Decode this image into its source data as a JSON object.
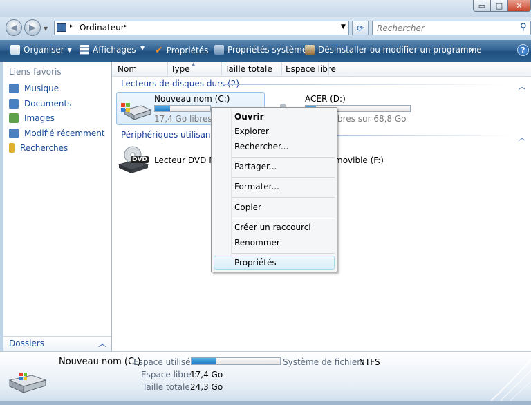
{
  "window": {
    "min_glyph": "▭",
    "max_glyph": "□",
    "close_glyph": "✕"
  },
  "address": {
    "path": "Ordinateur",
    "sep": "▸"
  },
  "search": {
    "placeholder": "Rechercher"
  },
  "toolbar": {
    "organize": "Organiser",
    "views": "Affichages",
    "properties": "Propriétés",
    "system_properties": "Propriétés système",
    "uninstall": "Désinstaller ou modifier un programme",
    "more": "»",
    "help": "?"
  },
  "sidebar": {
    "title": "Liens favoris",
    "items": [
      {
        "label": "Musique",
        "color": "#4a7fc0"
      },
      {
        "label": "Documents",
        "color": "#4a7fc0"
      },
      {
        "label": "Images",
        "color": "#5fa04a"
      },
      {
        "label": "Modifié récemment",
        "color": "#4a7fc0"
      },
      {
        "label": "Recherches",
        "color": "#e0b030"
      }
    ],
    "folders": "Dossiers"
  },
  "columns": [
    "Nom",
    "Type",
    "Taille totale",
    "Espace libre"
  ],
  "groups": {
    "hard_drives": "Lecteurs de disques durs (2)",
    "removable": "Périphériques utilisant de"
  },
  "drives": {
    "c": {
      "name": "Nouveau nom (C:)",
      "free_text": "17,4 Go libres sur",
      "used_fraction": 0.28
    },
    "d": {
      "name": "ACER (D:)",
      "free_text": "bres sur 68,8 Go",
      "used_fraction": 0.1
    },
    "dvd": {
      "name": "Lecteur DVD RW",
      "badge": "DVD"
    },
    "f": {
      "name": "movible (F:)"
    }
  },
  "context_menu": {
    "items": [
      "Ouvrir",
      "Explorer",
      "Rechercher...",
      "Partager...",
      "Formater...",
      "Copier",
      "Créer un raccourci",
      "Renommer",
      "Propriétés"
    ]
  },
  "details": {
    "name": "Nouveau nom (C:)",
    "used_label": "Espace utilisé :",
    "used_fraction": 0.28,
    "fs_label": "Système de fichiers :",
    "fs_value": "NTFS",
    "free_label": "Espace libre :",
    "free_value": "17,4 Go",
    "total_label": "Taille totale :",
    "total_value": "24,3 Go"
  },
  "colors": {
    "accent": "#1a4b9a",
    "cmdbar": "#2f6090",
    "bar_fill": "#1a78c4"
  }
}
